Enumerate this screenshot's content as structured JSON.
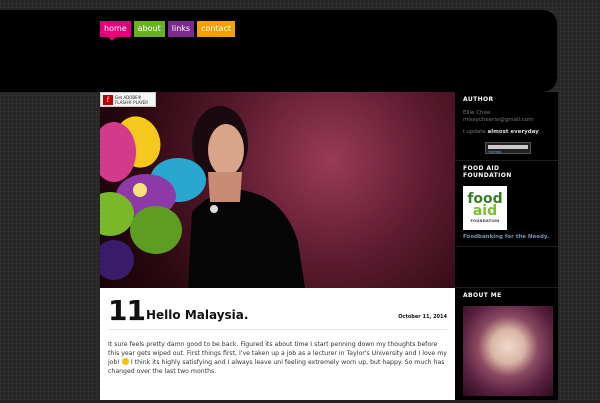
{
  "nav": {
    "items": [
      {
        "label": "home",
        "color": "#e3007a",
        "active": true
      },
      {
        "label": "about",
        "color": "#6ab023"
      },
      {
        "label": "links",
        "color": "#7b2a8f"
      },
      {
        "label": "contact",
        "color": "#f3a100"
      }
    ]
  },
  "hero": {
    "flash_badge": {
      "line1": "Get ADOBE®",
      "line2": "FLASH® PLAYER"
    }
  },
  "post": {
    "day": "11",
    "title": "Hello Malaysia.",
    "date": "October 11, 2014",
    "body_part1": "It sure feels pretty damn good to be back. Figured its about time I start penning down my thoughts before this year gets wiped out. First things first, I've taken up a job as a lecturer in Taylor's University and I love my job!",
    "body_part2": "I think its highly satisfying and I always leave uni feeling extremely worn up, but happy. So much has changed over the last two months."
  },
  "sidebar": {
    "author": {
      "heading": "AUTHOR",
      "name": "Ellie Chee",
      "email": "missycheerio@gmail.com",
      "update_prefix": "I update ",
      "update_bold": "almost everyday",
      "update_suffix": ".",
      "twitter_label": "TWITTER"
    },
    "food_aid": {
      "heading": "FOOD AID FOUNDATION",
      "logo_line1": "food",
      "logo_line2": "aid",
      "logo_line3": "FOUNDATION",
      "tagline": "Foodbanking for the Needy."
    },
    "about_me": {
      "heading": "ABOUT ME"
    }
  }
}
